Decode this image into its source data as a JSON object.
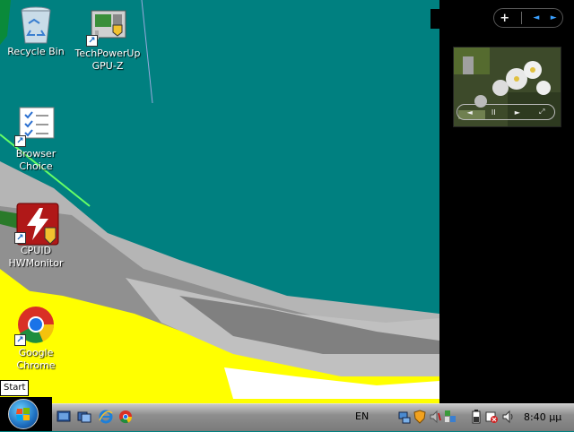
{
  "desktop": {
    "icons": [
      {
        "label": "Recycle Bin",
        "icon": "recycle-bin-icon"
      },
      {
        "label": "TechPowerUp\nGPU-Z",
        "icon": "gpu-z-icon"
      },
      {
        "label": "Browser\nChoice",
        "icon": "browser-choice-icon"
      },
      {
        "label": "CPUID\nHWMonitor",
        "icon": "hwmonitor-icon"
      },
      {
        "label": "Google\nChrome",
        "icon": "chrome-icon"
      }
    ]
  },
  "sidebar": {
    "controls": {
      "add": "+",
      "prev": "◄",
      "next": "►"
    },
    "slideshow": {
      "buttons": [
        "◄",
        "II",
        "►",
        "⤢"
      ]
    }
  },
  "start_tooltip": "Start",
  "taskbar": {
    "quick_launch": [
      "show-desktop-icon",
      "switch-windows-icon",
      "internet-explorer-icon",
      "chrome-icon"
    ],
    "language": "EN",
    "tray_icons": [
      "network-icon",
      "security-icon",
      "speaker-icon",
      "gadgets-icon",
      "battery-icon",
      "action-center-icon",
      "volume-icon"
    ],
    "clock": "8:40 μμ"
  },
  "colors": {
    "desktop_bg": "#008080",
    "sidebar_bg": "#000000",
    "taskbar": "#8e8e8e"
  }
}
